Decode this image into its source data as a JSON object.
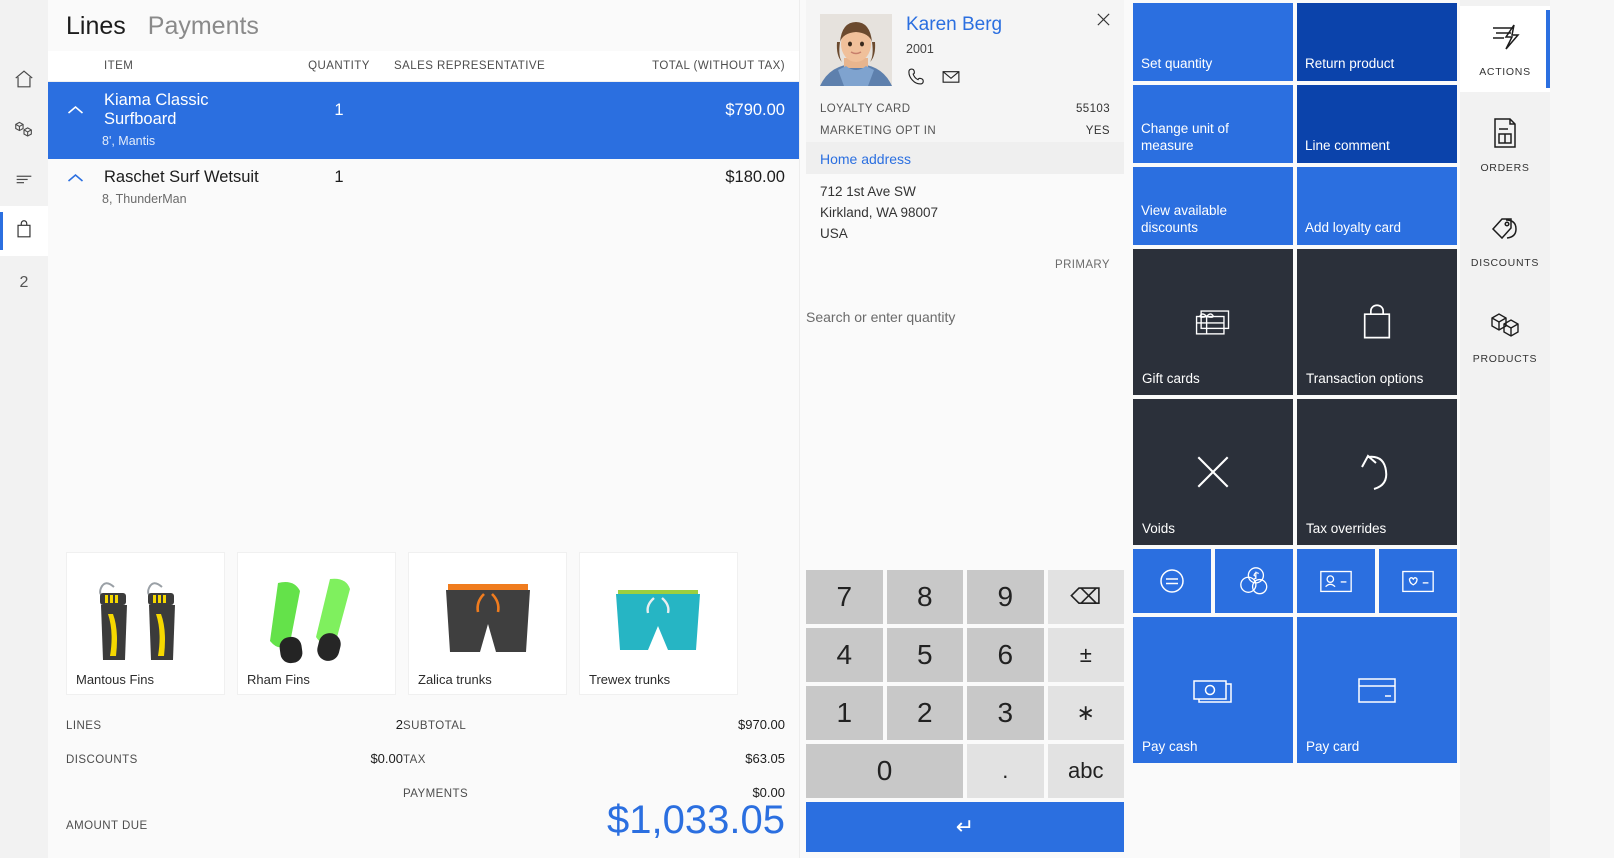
{
  "left_nav": {
    "items": [
      {
        "name": "home",
        "icon": "home-icon"
      },
      {
        "name": "products",
        "icon": "boxes-icon"
      },
      {
        "name": "lines",
        "icon": "list-icon"
      },
      {
        "name": "cart",
        "icon": "shopping-bag-icon"
      }
    ],
    "cart_count": "2"
  },
  "cart": {
    "tabs": [
      {
        "label": "Lines",
        "active": true
      },
      {
        "label": "Payments",
        "active": false
      }
    ],
    "columns": {
      "item": "ITEM",
      "quantity": "QUANTITY",
      "sales_representative": "SALES REPRESENTATIVE",
      "total": "TOTAL (WITHOUT TAX)"
    },
    "rows": [
      {
        "item": "Kiama Classic Surfboard",
        "variant": "8', Mantis",
        "quantity": "1",
        "sales_representative": "",
        "total": "$790.00",
        "selected": true
      },
      {
        "item": "Raschet Surf Wetsuit",
        "variant": "8, ThunderMan",
        "quantity": "1",
        "sales_representative": "",
        "total": "$180.00",
        "selected": false
      }
    ],
    "products": [
      {
        "name": "Mantous Fins",
        "image": "black-yellow-swim-fins"
      },
      {
        "name": "Rham Fins",
        "image": "green-swim-fins"
      },
      {
        "name": "Zalica trunks",
        "image": "dark-gray-orange-trunks"
      },
      {
        "name": "Trewex trunks",
        "image": "teal-trunks"
      }
    ],
    "totals_left": [
      {
        "label": "LINES",
        "value": "2"
      },
      {
        "label": "DISCOUNTS",
        "value": "$0.00"
      }
    ],
    "totals_right": [
      {
        "label": "SUBTOTAL",
        "value": "$970.00"
      },
      {
        "label": "TAX",
        "value": "$63.05"
      },
      {
        "label": "PAYMENTS",
        "value": "$0.00"
      }
    ],
    "amount_due_label": "AMOUNT DUE",
    "amount_due_value": "$1,033.05"
  },
  "customer": {
    "name": "Karen Berg",
    "id": "2001",
    "phone_icon": "phone-icon",
    "email_icon": "envelope-icon",
    "close_icon": "close-icon",
    "loyalty_card_label": "LOYALTY CARD",
    "loyalty_card_value": "55103",
    "marketing_label": "MARKETING OPT IN",
    "marketing_value": "YES",
    "address_header": "Home address",
    "address_line1": "712 1st Ave SW",
    "address_line2": "Kirkland, WA 98007",
    "address_line3": "USA",
    "primary_label": "PRIMARY"
  },
  "keypad": {
    "hint": "Search or enter quantity",
    "keys": [
      {
        "label": "7",
        "type": "digit"
      },
      {
        "label": "8",
        "type": "digit"
      },
      {
        "label": "9",
        "type": "digit"
      },
      {
        "label": "⌫",
        "type": "fn",
        "name": "backspace"
      },
      {
        "label": "4",
        "type": "digit"
      },
      {
        "label": "5",
        "type": "digit"
      },
      {
        "label": "6",
        "type": "digit"
      },
      {
        "label": "±",
        "type": "fn",
        "name": "plus-minus"
      },
      {
        "label": "1",
        "type": "digit"
      },
      {
        "label": "2",
        "type": "digit"
      },
      {
        "label": "3",
        "type": "digit"
      },
      {
        "label": "∗",
        "type": "fn",
        "name": "asterisk"
      },
      {
        "label": "0",
        "type": "digit-wide"
      },
      {
        "label": ".",
        "type": "digit"
      },
      {
        "label": "abc",
        "type": "fn",
        "name": "alpha"
      }
    ],
    "enter_label": "↵"
  },
  "tiles": [
    {
      "label": "Set quantity",
      "style": "blue",
      "size": "txt",
      "icon": null
    },
    {
      "label": "Return product",
      "style": "navy",
      "size": "txt",
      "icon": null
    },
    {
      "label": "Change unit of measure",
      "style": "blue",
      "size": "txt",
      "icon": null
    },
    {
      "label": "Line comment",
      "style": "navy",
      "size": "txt",
      "icon": null
    },
    {
      "label": "View available discounts",
      "style": "blue",
      "size": "txt",
      "icon": null
    },
    {
      "label": "Add loyalty card",
      "style": "blue",
      "size": "txt",
      "icon": null
    },
    {
      "label": "Gift cards",
      "style": "slate",
      "size": "big",
      "icon": "gift-card-icon"
    },
    {
      "label": "Transaction options",
      "style": "slate",
      "size": "big",
      "icon": "shopping-bag-icon"
    },
    {
      "label": "Voids",
      "style": "slate",
      "size": "big",
      "icon": "close-x-icon"
    },
    {
      "label": "Tax overrides",
      "style": "slate",
      "size": "big",
      "icon": "undo-arrow-icon"
    }
  ],
  "mini_tiles": [
    {
      "name": "price-check",
      "icon": "circle-equals-icon",
      "style": "blue"
    },
    {
      "name": "currency",
      "icon": "coins-icon",
      "style": "blue"
    },
    {
      "name": "customer-card",
      "icon": "id-card-icon",
      "style": "blue"
    },
    {
      "name": "loyalty",
      "icon": "card-heart-icon",
      "style": "blue"
    }
  ],
  "pay_tiles": [
    {
      "label": "Pay cash",
      "icon": "cash-icon",
      "style": "blue"
    },
    {
      "label": "Pay card",
      "icon": "credit-card-icon",
      "style": "blue"
    }
  ],
  "right_rail": [
    {
      "label": "ACTIONS",
      "icon": "lightning-lines-icon",
      "active": true
    },
    {
      "label": "ORDERS",
      "icon": "document-icon",
      "active": false
    },
    {
      "label": "DISCOUNTS",
      "icon": "tags-icon",
      "active": false
    },
    {
      "label": "PRODUCTS",
      "icon": "cubes-icon",
      "active": false
    }
  ],
  "colors": {
    "accent_blue": "#2b6fe0",
    "navy_blue": "#0b43ab",
    "slate": "#2b303a"
  }
}
